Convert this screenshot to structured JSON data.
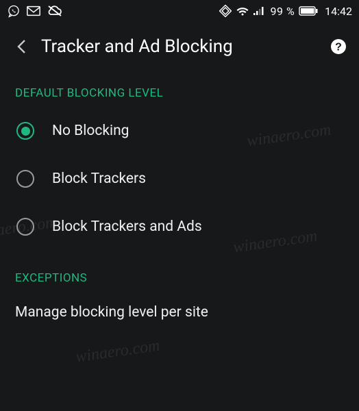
{
  "status_bar": {
    "battery_percent": "99 %",
    "clock": "14:42"
  },
  "header": {
    "title": "Tracker and Ad Blocking"
  },
  "sections": {
    "default_blocking": {
      "heading": "DEFAULT BLOCKING LEVEL",
      "options": [
        {
          "label": "No Blocking",
          "selected": true
        },
        {
          "label": "Block Trackers",
          "selected": false
        },
        {
          "label": "Block Trackers and Ads",
          "selected": false
        }
      ]
    },
    "exceptions": {
      "heading": "EXCEPTIONS",
      "manage_label": "Manage blocking level per site"
    }
  },
  "watermark_text": "winaero.com"
}
